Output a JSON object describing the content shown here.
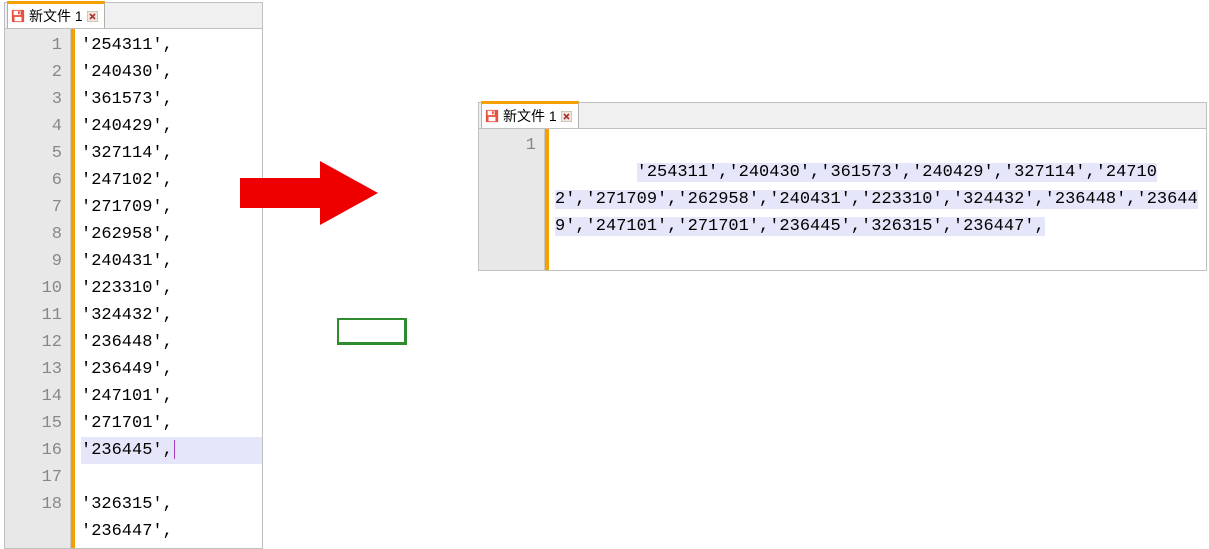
{
  "editor_a": {
    "tab_label": "新文件 1",
    "highlight_line": 16,
    "values": [
      "254311",
      "240430",
      "361573",
      "240429",
      "327114",
      "247102",
      "271709",
      "262958",
      "240431",
      "223310",
      "324432",
      "236448",
      "236449",
      "247101",
      "271701",
      "236445",
      "326315",
      "236447"
    ]
  },
  "editor_b": {
    "tab_label": "新文件 1",
    "line_number": "1",
    "values": [
      "254311",
      "240430",
      "361573",
      "240429",
      "327114",
      "247102",
      "271709",
      "262958",
      "240431",
      "223310",
      "324432",
      "236448",
      "236449",
      "247101",
      "271701",
      "236445",
      "326315",
      "236447"
    ]
  }
}
